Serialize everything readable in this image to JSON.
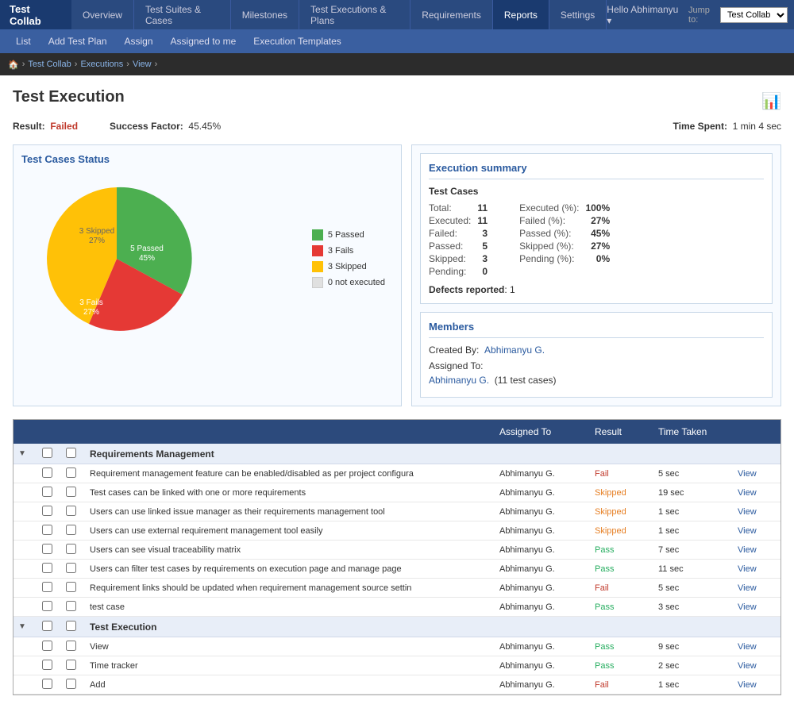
{
  "brand": "Test Collab",
  "nav": {
    "items": [
      {
        "label": "Overview",
        "active": false
      },
      {
        "label": "Test Suites & Cases",
        "active": false
      },
      {
        "label": "Milestones",
        "active": false
      },
      {
        "label": "Test Executions & Plans",
        "active": false
      },
      {
        "label": "Requirements",
        "active": false
      },
      {
        "label": "Reports",
        "active": true
      },
      {
        "label": "Settings",
        "active": false
      }
    ],
    "user": "Hello Abhimanyu ▾",
    "jump_to": "Jump to:",
    "jump_value": "Test Collab"
  },
  "sub_nav": {
    "items": [
      "List",
      "Add Test Plan",
      "Assign",
      "Assigned to me",
      "Execution Templates"
    ]
  },
  "breadcrumb": {
    "items": [
      "🏠",
      "Test Collab",
      "Executions",
      "View"
    ]
  },
  "page": {
    "title": "Test Execution",
    "result_label": "Result:",
    "result_value": "Failed",
    "success_label": "Success Factor:",
    "success_value": "45.45%",
    "time_label": "Time Spent:",
    "time_value": "1 min 4 sec"
  },
  "pie_chart": {
    "title": "Test Cases Status",
    "segments": [
      {
        "label": "5 Passed",
        "value": 5,
        "percent": 45,
        "color": "#4caf50",
        "startAngle": 0,
        "endAngle": 163
      },
      {
        "label": "3 Fails",
        "value": 3,
        "percent": 27,
        "color": "#e53935",
        "startAngle": 163,
        "endAngle": 260
      },
      {
        "label": "3 Skipped",
        "value": 3,
        "percent": 27,
        "color": "#ffc107",
        "startAngle": 260,
        "endAngle": 357
      },
      {
        "label": "0 not executed",
        "value": 0,
        "percent": 0,
        "color": "#e0e0e0",
        "startAngle": 357,
        "endAngle": 360
      }
    ]
  },
  "execution_summary": {
    "title": "Execution summary",
    "test_cases_label": "Test Cases",
    "rows_left": [
      {
        "label": "Total:",
        "value": "11"
      },
      {
        "label": "Executed:",
        "value": "11"
      },
      {
        "label": "Failed:",
        "value": "3"
      },
      {
        "label": "Passed:",
        "value": "5"
      },
      {
        "label": "Skipped:",
        "value": "3"
      },
      {
        "label": "Pending:",
        "value": "0"
      }
    ],
    "rows_right": [
      {
        "label": "Executed (%):",
        "value": "100%"
      },
      {
        "label": "Failed (%):",
        "value": "27%"
      },
      {
        "label": "Passed (%):",
        "value": "45%"
      },
      {
        "label": "Skipped (%):",
        "value": "27%"
      },
      {
        "label": "Pending (%):",
        "value": "0%"
      }
    ],
    "defects_label": "Defects reported",
    "defects_value": "1"
  },
  "members": {
    "title": "Members",
    "created_by_label": "Created By:",
    "created_by_value": "Abhimanyu G.",
    "assigned_to_label": "Assigned To:",
    "assigned_to_value": "Abhimanyu G.",
    "test_cases_count": "(11 test cases)"
  },
  "table": {
    "headers": [
      "",
      "",
      "",
      "Assigned To",
      "Result",
      "Time Taken",
      ""
    ],
    "groups": [
      {
        "label": "Requirements Management",
        "rows": [
          {
            "name": "Requirement management feature can be enabled/disabled as per project configura",
            "assigned": "Abhimanyu G.",
            "result": "Fail",
            "time": "5 sec",
            "result_class": "fail"
          },
          {
            "name": "Test cases can be linked with one or more requirements",
            "assigned": "Abhimanyu G.",
            "result": "Skipped",
            "time": "19 sec",
            "result_class": "skip"
          },
          {
            "name": "Users can use linked issue manager as their requirements management tool",
            "assigned": "Abhimanyu G.",
            "result": "Skipped",
            "time": "1 sec",
            "result_class": "skip"
          },
          {
            "name": "Users can use external requirement management tool easily",
            "assigned": "Abhimanyu G.",
            "result": "Skipped",
            "time": "1 sec",
            "result_class": "skip"
          },
          {
            "name": "Users can see visual traceability matrix",
            "assigned": "Abhimanyu G.",
            "result": "Pass",
            "time": "7 sec",
            "result_class": "pass"
          },
          {
            "name": "Users can filter test cases by requirements on execution page and manage page",
            "assigned": "Abhimanyu G.",
            "result": "Pass",
            "time": "11 sec",
            "result_class": "pass"
          },
          {
            "name": "Requirement links should be updated when requirement management source settin",
            "assigned": "Abhimanyu G.",
            "result": "Fail",
            "time": "5 sec",
            "result_class": "fail"
          },
          {
            "name": "test case",
            "assigned": "Abhimanyu G.",
            "result": "Pass",
            "time": "3 sec",
            "result_class": "pass"
          }
        ]
      },
      {
        "label": "Test Execution",
        "rows": [
          {
            "name": "View",
            "assigned": "Abhimanyu G.",
            "result": "Pass",
            "time": "9 sec",
            "result_class": "pass"
          },
          {
            "name": "Time tracker",
            "assigned": "Abhimanyu G.",
            "result": "Pass",
            "time": "2 sec",
            "result_class": "pass"
          },
          {
            "name": "Add",
            "assigned": "Abhimanyu G.",
            "result": "Fail",
            "time": "1 sec",
            "result_class": "fail"
          }
        ]
      }
    ],
    "view_label": "View"
  }
}
